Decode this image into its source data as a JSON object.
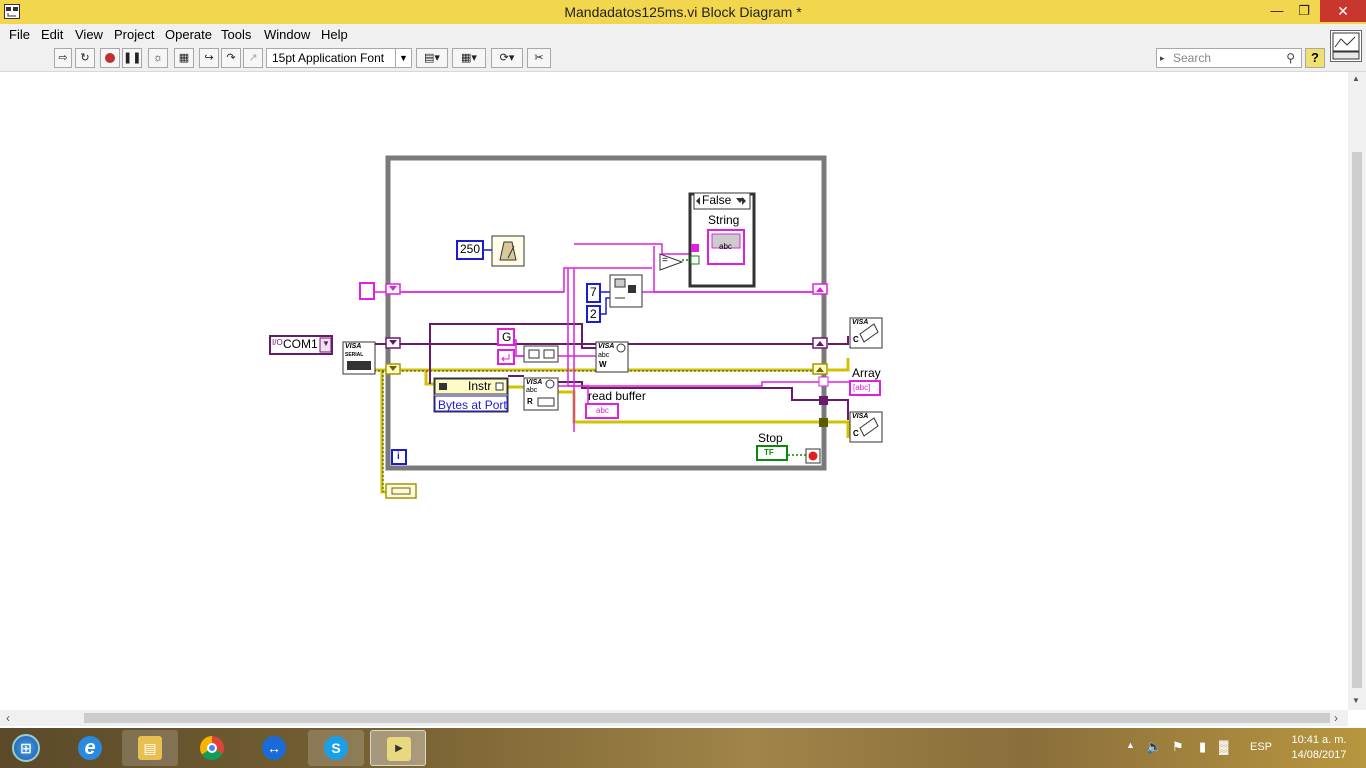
{
  "window": {
    "title": "Mandadatos125ms.vi Block Diagram *",
    "minimize": "—",
    "maximize": "❐",
    "close": "✕"
  },
  "menu": [
    "File",
    "Edit",
    "View",
    "Project",
    "Operate",
    "Tools",
    "Window",
    "Help"
  ],
  "toolbar": {
    "font_select": "15pt Application Font",
    "search_placeholder": "Search",
    "help": "?",
    "tools": [
      "run-arrow-icon",
      "run-continuously-icon",
      "abort-icon",
      "pause-icon",
      "highlight-execution-icon",
      "retain-wire-values-icon",
      "step-into-icon",
      "step-over-icon",
      "step-out-icon",
      "align-icon",
      "distribute-icon",
      "reorder-icon",
      "cleanup-icon"
    ]
  },
  "diagram": {
    "case_selector": "False",
    "string_label": "String",
    "string_terminal": "abc",
    "wait_constant": "250",
    "com_constant": "COM1",
    "visa_resource_prefix": "I/O",
    "num7": "7",
    "num2": "2",
    "char_constant": "G",
    "property_node_class": "Instr",
    "property_node_property": "Bytes at Port",
    "read_buffer_label": "read buffer",
    "read_buffer_terminal": "abc",
    "array_label": "Array",
    "array_terminal": "[abc]",
    "stop_label": "Stop",
    "stop_terminal": "TF",
    "iteration_terminal": "i",
    "visa_text": "VISA",
    "visa_serial_text": "SERIAL",
    "visa_write_letter": "W",
    "visa_read_letter": "R",
    "visa_close_letter": "C",
    "abc_small": "abc",
    "compare_symbol": "="
  },
  "taskbar": {
    "apps": [
      "start",
      "internet-explorer",
      "file-explorer",
      "chrome",
      "teamviewer",
      "skype",
      "labview"
    ],
    "tray_lang": "ESP",
    "time": "10:41 a. m.",
    "date": "14/08/2017"
  },
  "colors": {
    "titlebar": "#f2d74e",
    "close": "#c7372e",
    "string_wire": "#e020e0",
    "visa_wire": "#6a1a6a",
    "error_wire": "#cfc300",
    "numeric_blue": "#1c1cd0",
    "boolean_green": "#0a8a0a",
    "loop_border": "#7a7a7a"
  }
}
